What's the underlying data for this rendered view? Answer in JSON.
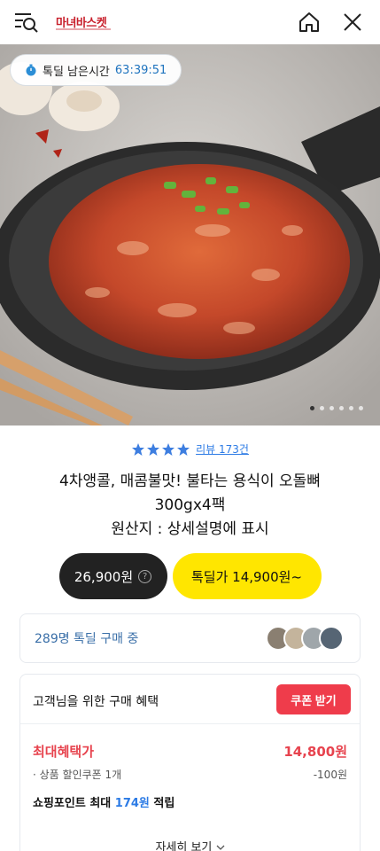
{
  "header": {
    "logo": "마녀바스켓",
    "icons": [
      "menu-search-icon",
      "home-icon",
      "close-icon"
    ]
  },
  "timer": {
    "label": "톡딜 남은시간",
    "value": "63:39:51"
  },
  "carousel": {
    "total": 6,
    "active": 1
  },
  "product": {
    "rating": 4,
    "review_label": "리뷰 173건",
    "title_line1": "4차앵콜, 매콤불맛! 불타는 용식이 오돌뼈",
    "title_line2": "300gx4팩",
    "title_line3": "원산지 : 상세설명에 표시"
  },
  "price": {
    "normal": "26,900원",
    "help_glyph": "?",
    "deal": "톡딜가 14,900원~"
  },
  "buyers": {
    "text": "289명 톡딜 구매 중"
  },
  "benefit": {
    "title": "고객님을 위한 구매 혜택",
    "coupon_button": "쿠폰 받기",
    "max_label": "최대혜택가",
    "max_value": "14,800원",
    "coupon_label": "상품 할인쿠폰 1개",
    "coupon_value": "-100원",
    "point_prefix": "쇼핑포인트 최대",
    "point_amount": "174원",
    "point_suffix": "적립",
    "detail_label": "자세히 보기"
  },
  "colors": {
    "deal_yellow": "#ffe600",
    "coupon_red": "#ef3c4b",
    "link_blue": "#2c7be5"
  }
}
